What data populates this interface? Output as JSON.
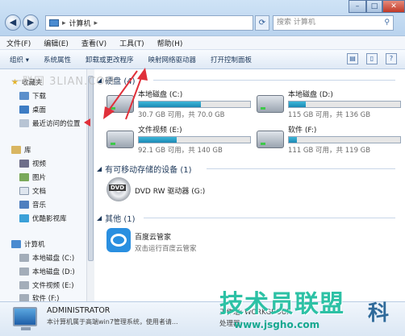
{
  "window": {
    "address": [
      "计算机"
    ],
    "search_placeholder": "搜索 计算机",
    "controls": {
      "minimize": "–",
      "maximize": "□",
      "close": "✕"
    }
  },
  "menu": [
    "文件(F)",
    "编辑(E)",
    "查看(V)",
    "工具(T)",
    "帮助(H)"
  ],
  "toolbar": {
    "organize": "组织 ▾",
    "system_properties": "系统属性",
    "uninstall": "卸载或更改程序",
    "map_drive": "映射网络驱动器",
    "control_panel": "打开控制面板"
  },
  "sidebar": {
    "favorites": "收藏夹",
    "downloads": "下载",
    "desktop": "桌面",
    "recent": "最近访问的位置",
    "libraries": "库",
    "videos": "视频",
    "pictures": "图片",
    "documents": "文档",
    "music": "音乐",
    "youku": "优酷影视库",
    "computer": "计算机",
    "drive_c": "本地磁盘 (C:)",
    "drive_d": "本地磁盘 (D:)",
    "drive_e": "文件视频 (E:)",
    "drive_f": "软件 (F:)"
  },
  "main": {
    "hard_disks_header": "硬盘 (4)",
    "drives": [
      {
        "name": "本地磁盘 (C:)",
        "space": "30.7 GB 可用，共 70.0 GB",
        "used_fraction": 0.56
      },
      {
        "name": "本地磁盘 (D:)",
        "space": "115 GB 可用，共 136 GB",
        "used_fraction": 0.15
      },
      {
        "name": "文件视频 (E:)",
        "space": "92.1 GB 可用，共 140 GB",
        "used_fraction": 0.34
      },
      {
        "name": "软件 (F:)",
        "space": "111 GB 可用，共 119 GB",
        "used_fraction": 0.07
      }
    ],
    "removable_header": "有可移动存储的设备 (1)",
    "dvd_name": "DVD RW 驱动器 (G:)",
    "other_header": "其他 (1)",
    "baidu_name": "百度云管家",
    "baidu_desc": "双击运行百度云管家"
  },
  "details": {
    "name": "ADMINISTRATOR",
    "desc": "本计算机属于高端win7管理系统，使用者请...",
    "workgroup_label": "工作组: WORKGROUP",
    "processor_label": "处理器:"
  },
  "watermarks": {
    "top": "一联网 3LIAN.COM",
    "big": "技术员联盟",
    "url": "www.jsgho.com",
    "side": "科"
  },
  "colors": {
    "bar_fill": "#1b89b5",
    "arrow": "#e0303a",
    "watermark": "#2dc1a5"
  }
}
